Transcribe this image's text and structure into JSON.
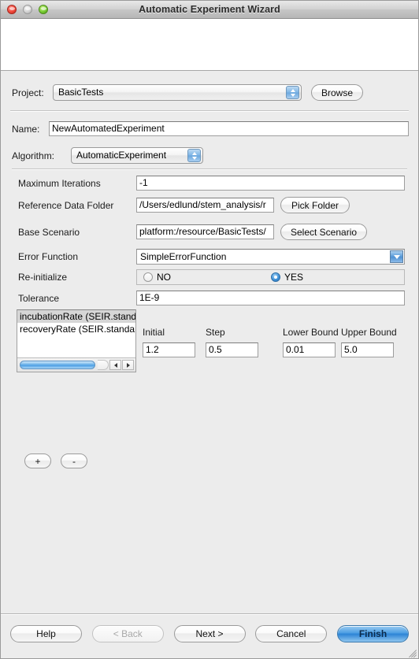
{
  "window": {
    "title": "Automatic Experiment Wizard",
    "traffic_lights": [
      "close",
      "minimize",
      "maximize"
    ]
  },
  "form": {
    "project": {
      "label": "Project:",
      "value": "BasicTests",
      "browse_label": "Browse"
    },
    "name": {
      "label": "Name:",
      "value": "NewAutomatedExperiment"
    },
    "algorithm": {
      "label": "Algorithm:",
      "value": "AutomaticExperiment"
    },
    "maximum_iterations": {
      "label": "Maximum Iterations",
      "value": "-1"
    },
    "reference_data_folder": {
      "label": "Reference Data Folder",
      "value": "/Users/edlund/stem_analysis/r",
      "button_label": "Pick Folder"
    },
    "base_scenario": {
      "label": "Base Scenario",
      "value": "platform:/resource/BasicTests/",
      "button_label": "Select Scenario"
    },
    "error_function": {
      "label": "Error Function",
      "value": "SimpleErrorFunction"
    },
    "reinitialize": {
      "label": "Re-initialize",
      "options": [
        {
          "label": "NO",
          "selected": false
        },
        {
          "label": "YES",
          "selected": true
        }
      ]
    },
    "tolerance": {
      "label": "Tolerance",
      "value": "1E-9"
    }
  },
  "parameters": {
    "list_items": [
      {
        "label": "incubationRate (SEIR.standa",
        "selected": true
      },
      {
        "label": "recoveryRate (SEIR.standard",
        "selected": false
      }
    ],
    "add_label": "+",
    "remove_label": "-",
    "columns": [
      {
        "header": "Initial",
        "value": "1.2"
      },
      {
        "header": "Step",
        "value": "0.5"
      },
      {
        "header": "Lower Bound",
        "value": "0.01"
      },
      {
        "header": "Upper Bound",
        "value": "5.0"
      }
    ]
  },
  "footer": {
    "help": "Help",
    "back": "< Back",
    "next": "Next >",
    "cancel": "Cancel",
    "finish": "Finish"
  },
  "colors": {
    "window_bg": "#ececec",
    "accent_blue": "#4e9fe3",
    "selection_gray": "#d6d6d6"
  }
}
